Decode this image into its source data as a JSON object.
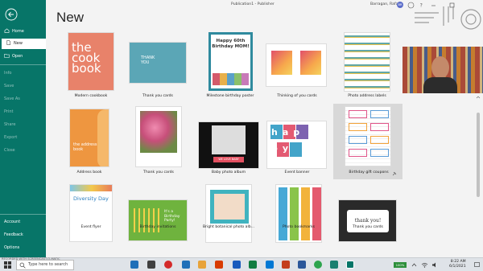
{
  "window": {
    "doc_title": "Publication1  -  Publisher",
    "user_name": "Barragan, Rafael",
    "user_initials": "BR"
  },
  "sidebar": {
    "top": [
      {
        "label": "Home",
        "icon": "home-icon"
      },
      {
        "label": "New",
        "icon": "new-document-icon"
      },
      {
        "label": "Open",
        "icon": "folder-open-icon"
      }
    ],
    "mid": [
      {
        "label": "Info"
      },
      {
        "label": "Save"
      },
      {
        "label": "Save As"
      },
      {
        "label": "Print"
      },
      {
        "label": "Share"
      },
      {
        "label": "Export"
      },
      {
        "label": "Close"
      }
    ],
    "bottom": [
      {
        "label": "Account"
      },
      {
        "label": "Feedback"
      },
      {
        "label": "Options"
      }
    ]
  },
  "page": {
    "heading": "New"
  },
  "templates": {
    "row1": [
      {
        "caption": "Modern cookbook",
        "thumb_text": "the cook book"
      },
      {
        "caption": "Thank you cards",
        "thumb_text": "THANK YOU"
      },
      {
        "caption": "Milestone birthday poster",
        "thumb_text": "Happy 60th Birthday MOM!"
      },
      {
        "caption": "Thinking of you cards",
        "thumb_text": ""
      },
      {
        "caption": "Photo address labels",
        "thumb_text": ""
      }
    ],
    "row2": [
      {
        "caption": "Address book",
        "thumb_text": "the address book"
      },
      {
        "caption": "Thank you cards",
        "thumb_text": ""
      },
      {
        "caption": "Baby photo album",
        "thumb_text": "WE LOVE BABY"
      },
      {
        "caption": "Event banner",
        "thumb_text": "hap py"
      },
      {
        "caption": "Birthday gift coupons",
        "thumb_text": ""
      }
    ],
    "row3": [
      {
        "caption": "Event flyer",
        "thumb_text": "Diversity Day"
      },
      {
        "caption": "Birthday invitations",
        "thumb_text": "It's a Birthday Party!"
      },
      {
        "caption": "Bright botanical photo alb...",
        "thumb_text": ""
      },
      {
        "caption": "Photo bookmarks",
        "thumb_text": ""
      },
      {
        "caption": "Thank you cards",
        "thumb_text": "thank you!"
      }
    ]
  },
  "taskbar": {
    "search_placeholder": "Type here to search",
    "time": "8:22 AM",
    "date": "6/1/2021",
    "battery": "100%",
    "recorder_label": "RECORDED WITH SCREENCAST-O-MATIC"
  },
  "colors": {
    "sidebar": "#077568",
    "accent": "#077568"
  }
}
